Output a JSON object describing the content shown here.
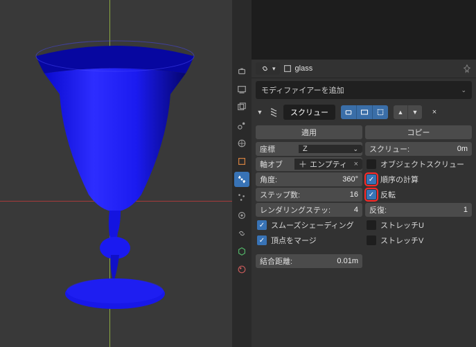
{
  "object": {
    "name": "glass"
  },
  "add_modifier": {
    "label": "モディファイアーを追加"
  },
  "modifier": {
    "name": "スクリュー",
    "apply": "適用",
    "copy": "コピー",
    "close": "×"
  },
  "fields": {
    "axis_label": "座標",
    "axis_value": "Z",
    "axis_object_label": "軸オブ",
    "axis_object_value": "エンプティ",
    "angle_label": "角度:",
    "angle_value": "360°",
    "steps_label": "ステップ数:",
    "steps_value": "16",
    "rendersteps_label": "レンダリングステッ:",
    "rendersteps_value": "4",
    "smooth": "スムーズシェーディング",
    "merge": "頂点をマージ",
    "merge_dist_label": "結合距離:",
    "merge_dist_value": "0.01m",
    "screw_label": "スクリュー:",
    "screw_value": "0m",
    "object_screw": "オブジェクトスクリュー",
    "calc_order": "順序の計算",
    "flip": "反転",
    "iter_label": "反復:",
    "iter_value": "1",
    "stretch_u": "ストレッチU",
    "stretch_v": "ストレッチV"
  },
  "colors": {
    "accent": "#3873b6",
    "hl": "#ff2a2a"
  }
}
